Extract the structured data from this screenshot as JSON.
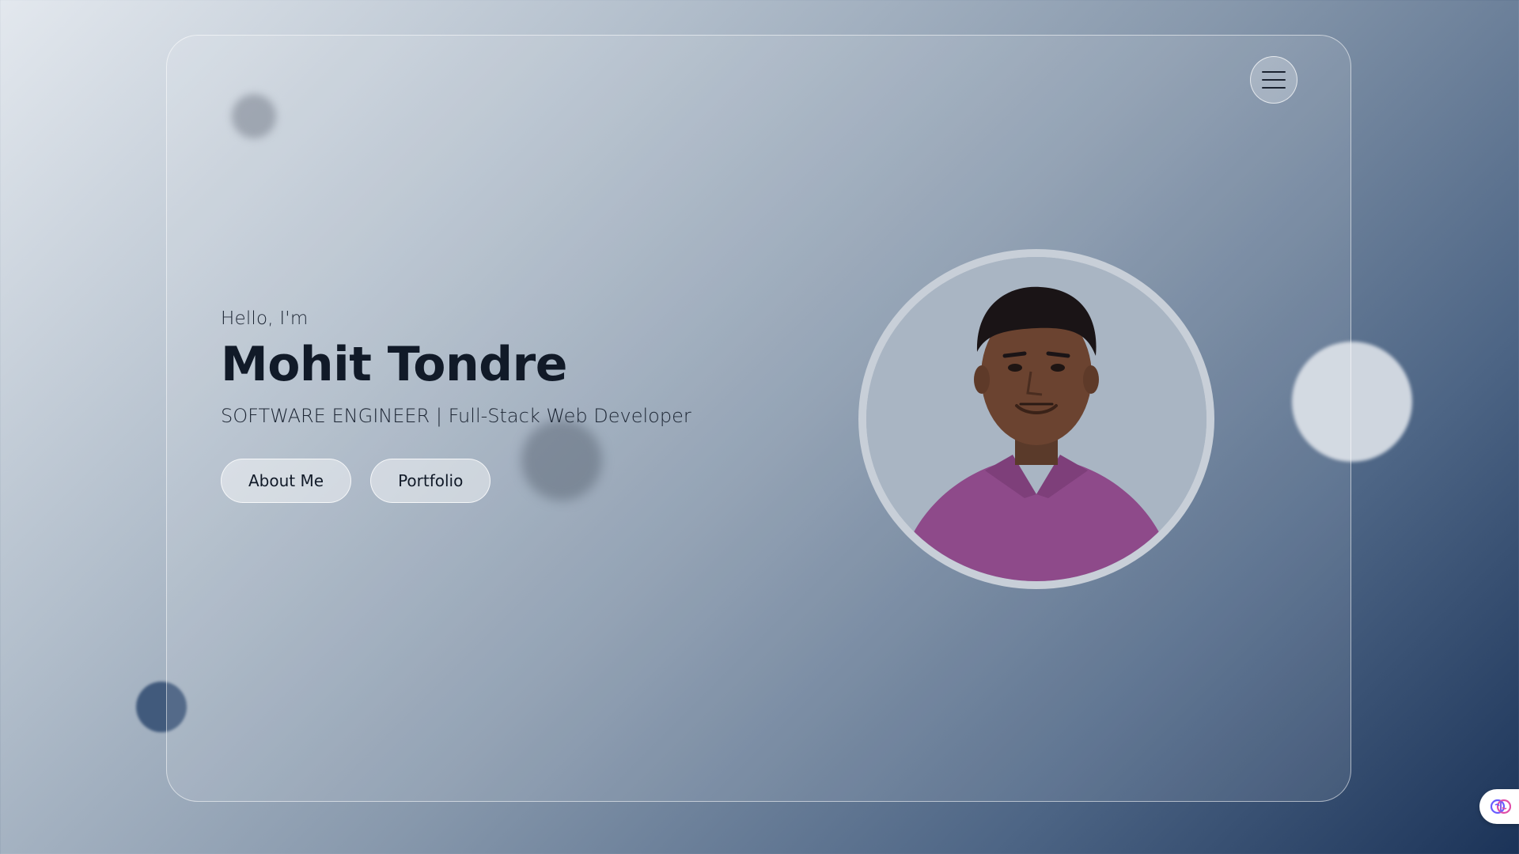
{
  "hero": {
    "greeting": "Hello, I'm",
    "name": "Mohit Tondre",
    "role": "SOFTWARE ENGINEER | Full-Stack Web Developer"
  },
  "buttons": {
    "about_label": "About Me",
    "portfolio_label": "Portfolio"
  },
  "menu": {
    "icon": "hamburger-menu-icon"
  },
  "photo": {
    "alt": "Portrait of Mohit Tondre"
  },
  "widget": {
    "icon": "brain-icon"
  },
  "colors": {
    "accent_shirt": "#8e4a8a",
    "text_dark": "#111a28"
  }
}
